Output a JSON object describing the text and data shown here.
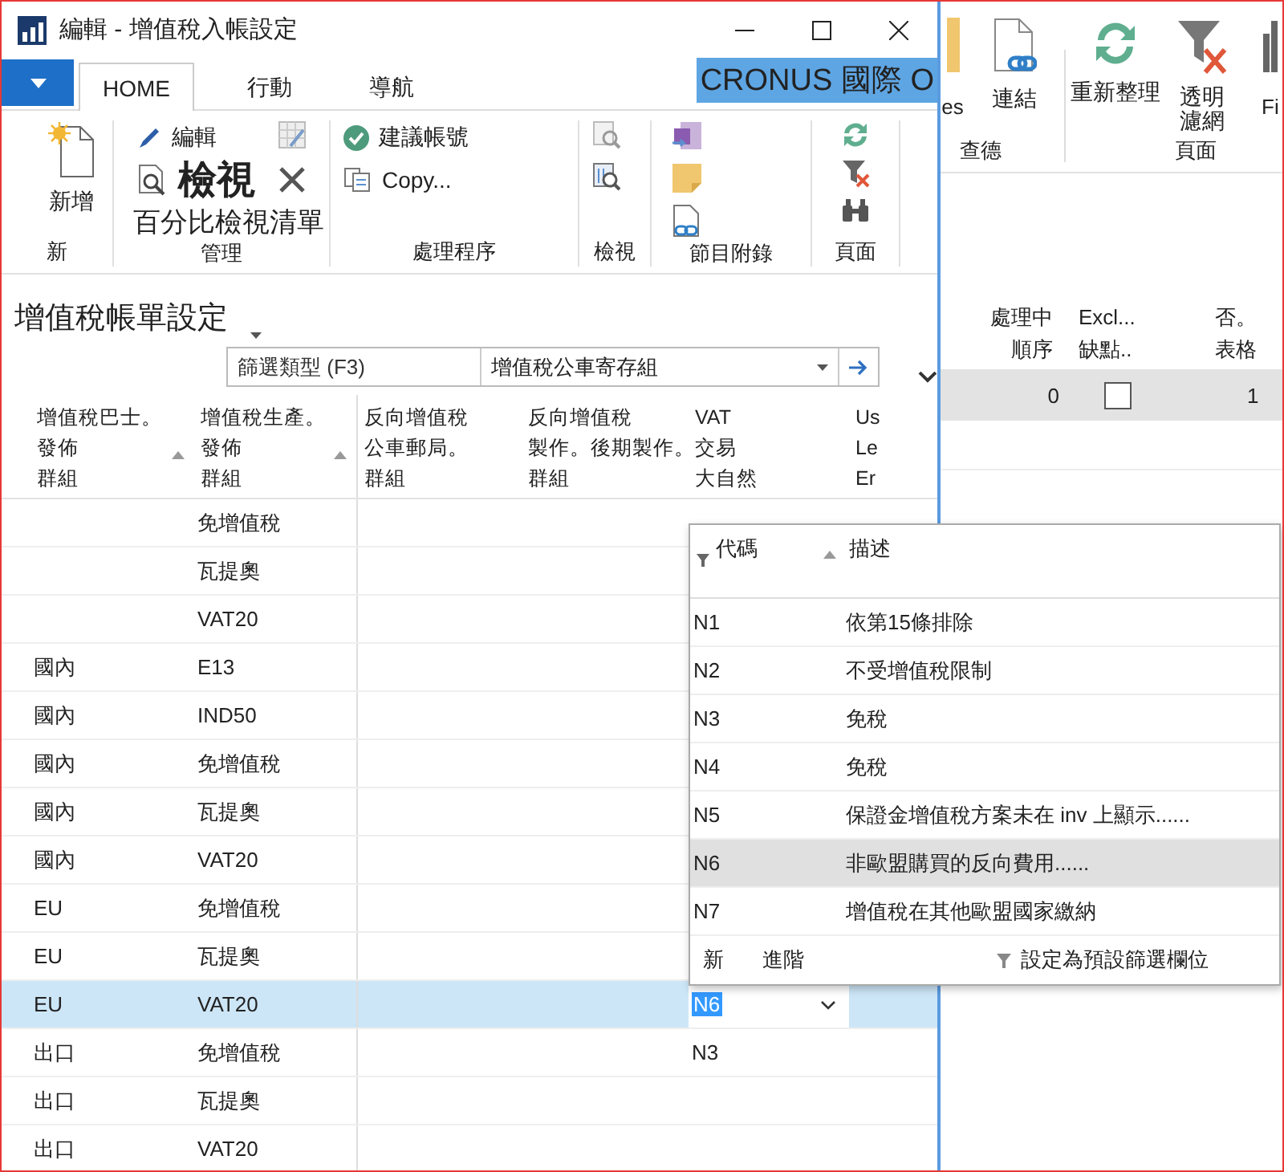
{
  "window": {
    "title": "編輯 - 增值稅入帳設定",
    "company": "CRONUS 國際 O"
  },
  "tabs": [
    {
      "label": "HOME",
      "selected": true
    },
    {
      "label": "行動",
      "selected": false
    },
    {
      "label": "導航",
      "selected": false
    }
  ],
  "ribbon": {
    "new": {
      "label": "新",
      "new_button": "新增"
    },
    "manage": {
      "label": "管理",
      "edit": "編輯",
      "view": "檢視",
      "percent_list": "百分比檢視清單"
    },
    "process": {
      "label": "處理程序",
      "suggest": "建議帳號",
      "copy": "Copy..."
    },
    "view": {
      "label": "檢視"
    },
    "attachments": {
      "label": "節目附錄"
    },
    "page": {
      "label": "頁面"
    }
  },
  "page": {
    "title": "增值稅帳單設定",
    "filter": {
      "placeholder": "篩選類型 (F3)",
      "field": "增值稅公車寄存組"
    },
    "columns": [
      {
        "lines": [
          "增值稅巴士。",
          "發佈",
          "群組"
        ],
        "sorted": true
      },
      {
        "lines": [
          "增值稅生產。",
          "發佈",
          "群組"
        ],
        "sorted": true
      },
      {
        "lines": [
          "反向增值稅",
          "公車郵局。",
          "群組"
        ],
        "sorted": false
      },
      {
        "lines": [
          "反向增值稅",
          "製作。後期製作。",
          "群組"
        ],
        "sorted": false
      },
      {
        "lines": [
          "VAT",
          "交易",
          "大自然"
        ],
        "sorted": false
      },
      {
        "lines": [
          "Us",
          "Le",
          "Er"
        ],
        "sorted": false
      }
    ],
    "rows": [
      {
        "product": "免增值稅",
        "selected": false
      },
      {
        "product": "瓦提奧",
        "selected": false
      },
      {
        "product": "VAT20",
        "selected": false
      },
      {
        "business": "國內",
        "product": "E13",
        "selected": false
      },
      {
        "business": "國內",
        "product": "IND50",
        "selected": false
      },
      {
        "business": "國內",
        "product": "免增值稅",
        "selected": false
      },
      {
        "business": "國內",
        "product": "瓦提奧",
        "selected": false
      },
      {
        "business": "國內",
        "product": "VAT20",
        "selected": false
      },
      {
        "business": "EU",
        "product": "免增值稅",
        "selected": false
      },
      {
        "business": "EU",
        "product": "瓦提奧",
        "selected": false
      },
      {
        "business": "EU",
        "product": "VAT20",
        "nature": "N6",
        "selected": true
      },
      {
        "business": "出口",
        "product": "免增值稅",
        "nature": "N3",
        "selected": false
      },
      {
        "business": "出口",
        "product": "瓦提奧",
        "selected": false
      },
      {
        "business": "出口",
        "product": "VAT20",
        "selected": false
      }
    ]
  },
  "lookup": {
    "columns": [
      {
        "label": "代碼",
        "sorted": true
      },
      {
        "label": "描述",
        "sorted": false
      }
    ],
    "rows": [
      {
        "code": "N1",
        "description": "依第15條排除",
        "selected": false
      },
      {
        "code": "N2",
        "description": "不受增值稅限制",
        "selected": false
      },
      {
        "code": "N3",
        "description": "免稅",
        "selected": false
      },
      {
        "code": "N4",
        "description": "免稅",
        "selected": false
      },
      {
        "code": "N5",
        "description": "保證金增值稅方案未在 inv 上顯示......",
        "selected": false
      },
      {
        "code": "N6",
        "description": "非歐盟購買的反向費用......",
        "selected": true
      },
      {
        "code": "N7",
        "description": "增值稅在其他歐盟國家繳納",
        "selected": false
      }
    ],
    "footer": {
      "new": "新",
      "advanced": "進階",
      "set_default": "設定為預設篩選欄位"
    }
  },
  "back_window": {
    "ribbon": {
      "partial_action": "es",
      "link": "連結",
      "refresh": "重新整理",
      "clear_filter": [
        "透明",
        "濾網"
      ],
      "partial_next": "Fi",
      "partial_group": "查德",
      "page_group": "頁面"
    },
    "columns": [
      {
        "lines": [
          "處理中",
          "順序"
        ]
      },
      {
        "lines": [
          "Excl...",
          "缺點.."
        ]
      },
      {
        "lines": [
          "否。",
          "表格"
        ]
      }
    ],
    "row": {
      "sequence": "0",
      "excluded": false,
      "column_3": "1"
    }
  }
}
